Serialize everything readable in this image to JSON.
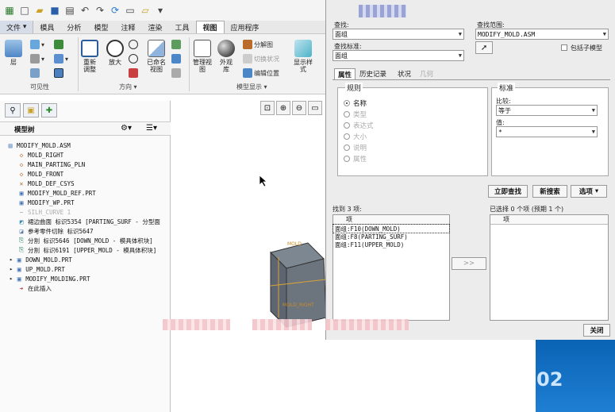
{
  "menu_tabs": [
    "文件",
    "模具",
    "分析",
    "模型",
    "注释",
    "渲染",
    "工具",
    "视图",
    "应用程序"
  ],
  "ribbon": {
    "visibility_buttons": [
      "层"
    ],
    "orientation_buttons": [
      "重新调整",
      "放大",
      "已命名视图"
    ],
    "display_buttons": [
      "管理视图",
      "外观库",
      "显示样式"
    ],
    "small_items": [
      "分解图",
      "切换状况",
      "编辑位置"
    ],
    "group_labels": [
      "可见性",
      "方向",
      "模型显示"
    ]
  },
  "model_tree": {
    "title": "模型树",
    "items": [
      {
        "label": "MODIFY_MOLD.ASM",
        "icon": "assembly-icon",
        "expand": ""
      },
      {
        "label": "MOLD_RIGHT",
        "icon": "datum-plane-icon",
        "expand": ""
      },
      {
        "label": "MAIN_PARTING_PLN",
        "icon": "datum-plane-icon",
        "expand": ""
      },
      {
        "label": "MOLD_FRONT",
        "icon": "datum-plane-icon",
        "expand": ""
      },
      {
        "label": "MOLD_DEF_CSYS",
        "icon": "csys-icon",
        "expand": ""
      },
      {
        "label": "MODIFY_MOLD_REF.PRT",
        "icon": "part-icon",
        "expand": ""
      },
      {
        "label": "MODIFY_WP.PRT",
        "icon": "part-icon",
        "expand": ""
      },
      {
        "label": "SILH_CURVE 1",
        "icon": "curve-icon",
        "expand": ""
      },
      {
        "label": "裙边曲面 标识5354 [PARTING_SURF - 分型面",
        "icon": "surface-icon",
        "expand": ""
      },
      {
        "label": "参考零件切除 标识5647",
        "icon": "cut-icon",
        "expand": ""
      },
      {
        "label": "分割 标识5646 [DOWN_MOLD - 模具体积块]",
        "icon": "split-icon",
        "expand": ""
      },
      {
        "label": "分割 标识6191 [UPPER_MOLD - 模具体积块]",
        "icon": "split-icon",
        "expand": ""
      },
      {
        "label": "DOWN_MOLD.PRT",
        "icon": "part-icon",
        "expand": "▸"
      },
      {
        "label": "UP_MOLD.PRT",
        "icon": "part-icon",
        "expand": "▸"
      },
      {
        "label": "MODIFY_MOLDING.PRT",
        "icon": "part-icon",
        "expand": "▸"
      },
      {
        "label": "在此插入",
        "icon": "insert-here-icon",
        "expand": ""
      }
    ]
  },
  "graphics": {
    "labels": [
      "MOLD",
      "MOLD_RIGHT"
    ]
  },
  "dialog": {
    "search_for_label": "查找:",
    "search_for_value": "面组",
    "find_scope_label": "查找范围:",
    "find_scope_value": "MODIFY_MOLD.ASM",
    "by_label": "查找标准:",
    "by_value": "面组",
    "include_submodels": "包括子模型",
    "tabs": [
      "属性",
      "历史记录",
      "状况",
      "几何"
    ],
    "rule_title": "规则",
    "rules": [
      "名称",
      "类型",
      "表达式",
      "大小",
      "说明",
      "属性"
    ],
    "criteria_title": "标准",
    "compare_label": "比较:",
    "compare_value": "等于",
    "value_label": "值:",
    "value_value": "*",
    "find_now": "立即查找",
    "new_search": "新搜索",
    "options": "选项",
    "found_label": "找到 3 项:",
    "selected_label": "已选择 0 个项 (预期 1 个)",
    "column_item": "项",
    "found_items": [
      "面组:F10(DOWN_MOLD)",
      "面组:F8(PARTING_SURF)",
      "面组:F11(UPPER_MOLD)"
    ],
    "transfer_btn": ">>",
    "close": "关闭"
  },
  "overlay_text": "02"
}
